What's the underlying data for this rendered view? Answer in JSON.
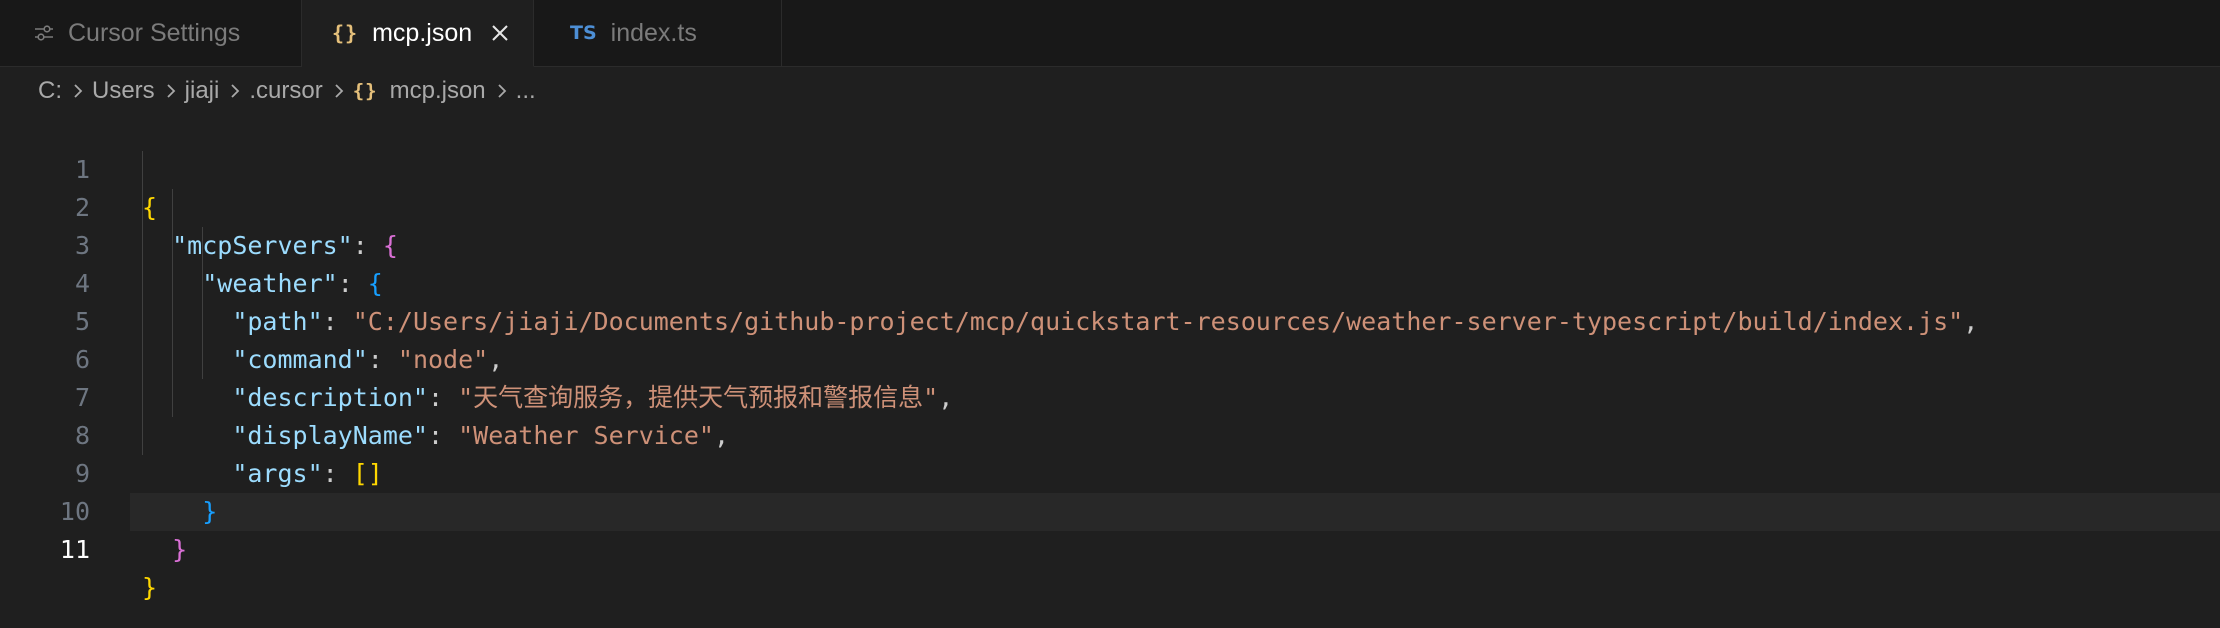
{
  "tabs": [
    {
      "label": "Cursor Settings",
      "icon": "sliders-icon",
      "active": false
    },
    {
      "label": "mcp.json",
      "icon": "json-braces-icon",
      "icon_text": "{}",
      "active": true
    },
    {
      "label": "index.ts",
      "icon": "typescript-icon",
      "icon_text": "TS",
      "active": false
    }
  ],
  "breadcrumb": {
    "items": [
      "C:",
      "Users",
      "jiaji",
      ".cursor",
      "mcp.json",
      "..."
    ],
    "file_icon_text": "{}"
  },
  "editor": {
    "current_line": 11,
    "lines": [
      {
        "n": "1"
      },
      {
        "n": "2",
        "key": "\"mcpServers\""
      },
      {
        "n": "3",
        "key": "\"weather\""
      },
      {
        "n": "4",
        "key": "\"path\"",
        "value": "\"C:/Users/jiaji/Documents/github-project/mcp/quickstart-resources/weather-server-typescript/build/index.js\""
      },
      {
        "n": "5",
        "key": "\"command\"",
        "value": "\"node\""
      },
      {
        "n": "6",
        "key": "\"description\"",
        "value": "\"天气查询服务，提供天气预报和警报信息\""
      },
      {
        "n": "7",
        "key": "\"displayName\"",
        "value": "\"Weather Service\""
      },
      {
        "n": "8",
        "key": "\"args\""
      },
      {
        "n": "9"
      },
      {
        "n": "10"
      },
      {
        "n": "11"
      }
    ]
  },
  "colors": {
    "key": "#9cdcfe",
    "string": "#ce9178",
    "bracket_level1": "#ffd700",
    "bracket_level2": "#da70d6",
    "bracket_level3": "#179fff"
  }
}
